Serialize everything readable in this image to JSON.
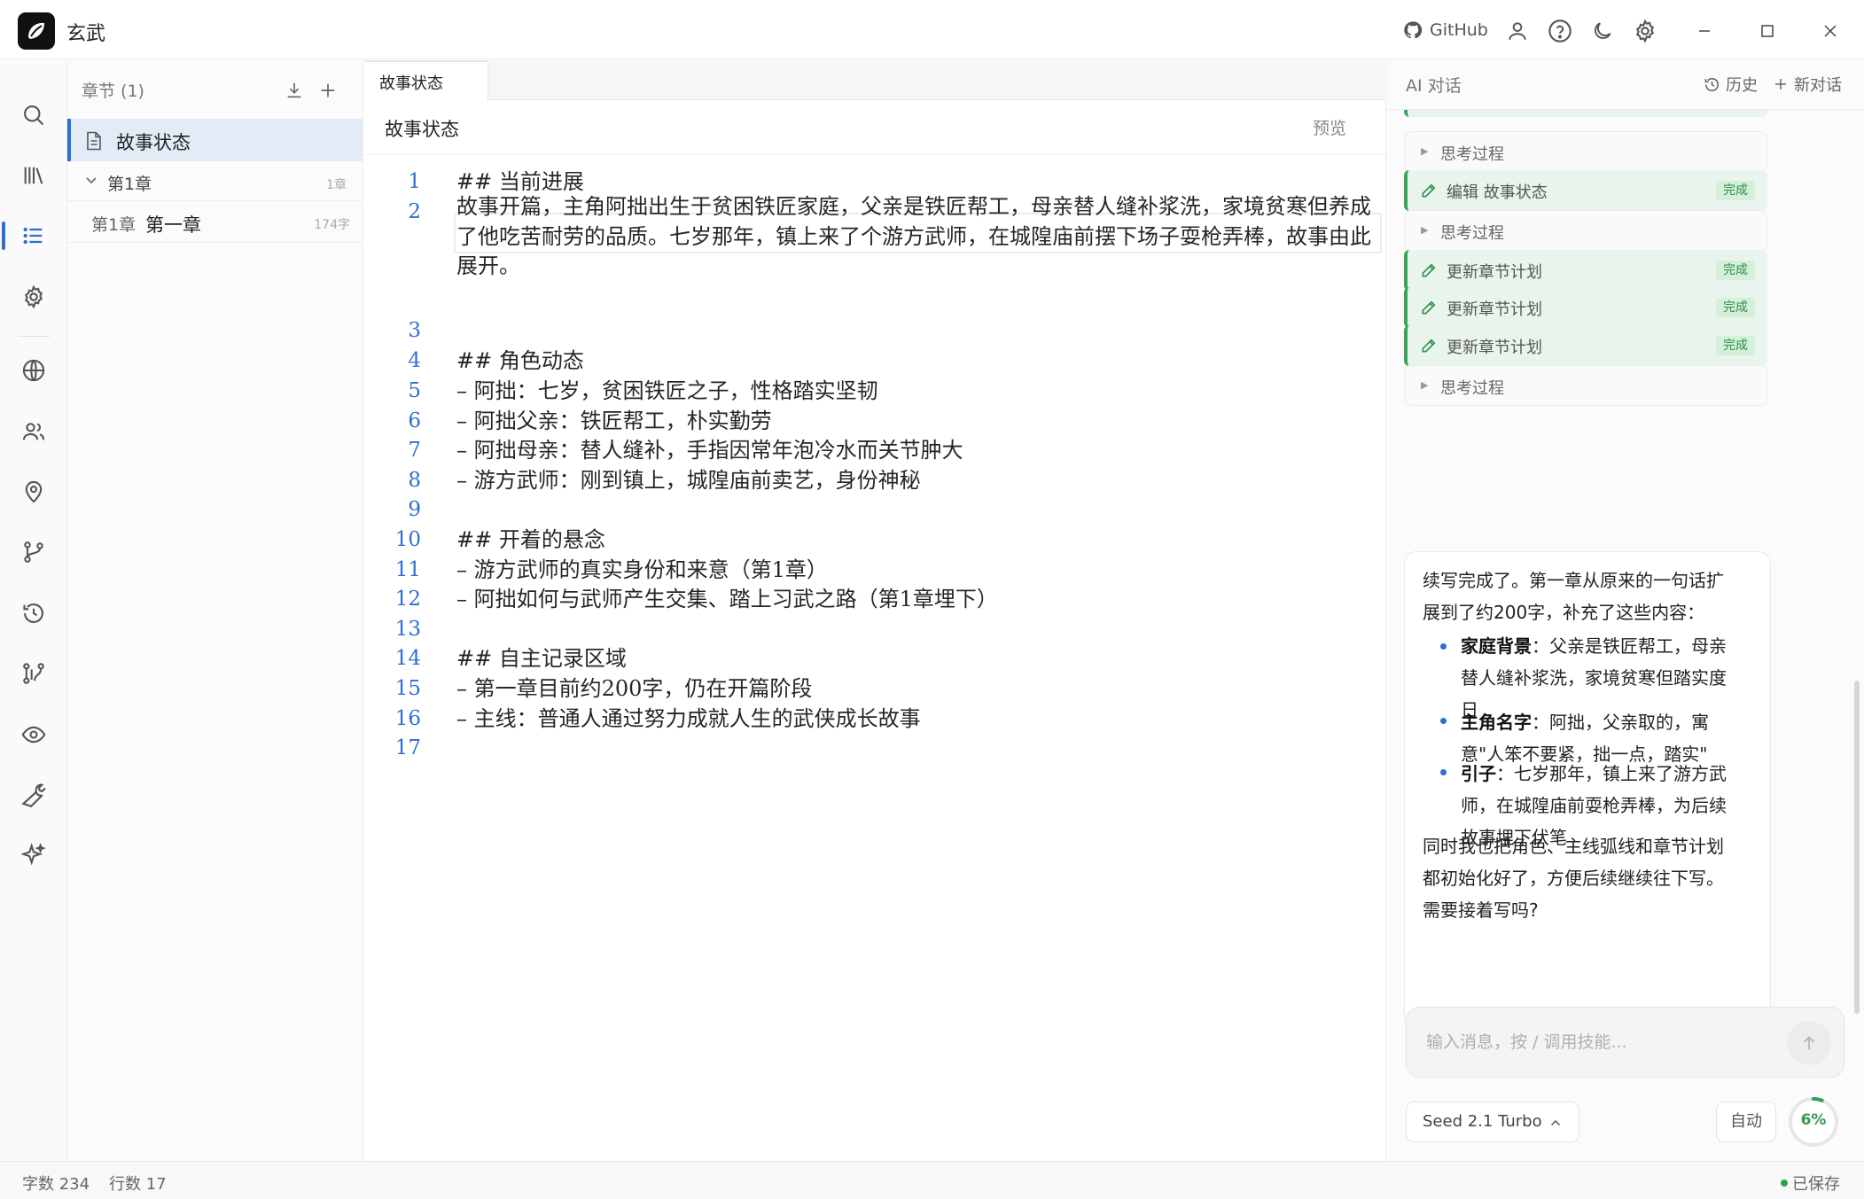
{
  "app": {
    "name": "玄武"
  },
  "titlebar": {
    "github_label": "GitHub"
  },
  "sidebar": {
    "header": "章节 (1)",
    "active_item": "故事状态",
    "volume": {
      "label": "第1章",
      "count": "1章"
    },
    "chapter": {
      "number": "第1章",
      "title": "第一章",
      "count": "174字"
    }
  },
  "editor": {
    "tab_label": "故事状态",
    "title": "故事状态",
    "preview_label": "预览",
    "lines": [
      {
        "n": "1",
        "text": "##  当前进展"
      },
      {
        "n": "2",
        "text": "故事开篇，主角阿拙出生于贫困铁匠家庭，父亲是铁匠帮工，母亲替人缝补浆洗，家境贫寒但养成了他吃苦耐劳的品质。七岁那年，镇上来了个游方武师，在城隍庙前摆下场子耍枪弄棒，故事由此展开。"
      },
      {
        "n": "3",
        "text": ""
      },
      {
        "n": "4",
        "text": "##  角色动态"
      },
      {
        "n": "5",
        "text": "–  阿拙：七岁，贫困铁匠之子，性格踏实坚韧"
      },
      {
        "n": "6",
        "text": "–  阿拙父亲：铁匠帮工，朴实勤劳"
      },
      {
        "n": "7",
        "text": "–  阿拙母亲：替人缝补，手指因常年泡冷水而关节肿大"
      },
      {
        "n": "8",
        "text": "–  游方武师：刚到镇上，城隍庙前卖艺，身份神秘"
      },
      {
        "n": "9",
        "text": ""
      },
      {
        "n": "10",
        "text": "##  开着的悬念"
      },
      {
        "n": "11",
        "text": "–  游方武师的真实身份和来意（第1章）"
      },
      {
        "n": "12",
        "text": "–  阿拙如何与武师产生交集、踏上习武之路（第1章埋下）"
      },
      {
        "n": "13",
        "text": ""
      },
      {
        "n": "14",
        "text": "##  自主记录区域"
      },
      {
        "n": "15",
        "text": "–  第一章目前约200字，仍在开篇阶段"
      },
      {
        "n": "16",
        "text": "–  主线：普通人通过努力成就人生的武侠成长故事"
      },
      {
        "n": "17",
        "text": ""
      }
    ]
  },
  "ai": {
    "title": "AI 对话",
    "history_label": "历史",
    "new_chat_label": "新对话",
    "blocks": [
      {
        "kind": "think",
        "label": "思考过程"
      },
      {
        "kind": "tool",
        "label": "编辑 故事状态",
        "status": "完成"
      },
      {
        "kind": "think",
        "label": "思考过程"
      },
      {
        "kind": "tool",
        "label": "更新章节计划",
        "status": "完成"
      },
      {
        "kind": "tool",
        "label": "更新章节计划",
        "status": "完成"
      },
      {
        "kind": "tool",
        "label": "更新章节计划",
        "status": "完成"
      },
      {
        "kind": "think",
        "label": "思考过程"
      }
    ],
    "message": {
      "intro_l1": "续写完成了。第一章从原来的一句话扩",
      "intro_l2": "展到了约200字，补充了这些内容：",
      "b1_title": "家庭背景",
      "b1_l1": "：父亲是铁匠帮工，母亲",
      "b1_l2": "替人缝补浆洗，家境贫寒但踏实度",
      "b1_l3": "日",
      "b2_title": "主角名字",
      "b2_l1": "：阿拙，父亲取的，寓",
      "b2_l2": "意\"人笨不要紧，拙一点，踏实\"",
      "b3_title": "引子",
      "b3_l1": "：七岁那年，镇上来了游方武",
      "b3_l2": "师，在城隍庙前耍枪弄棒，为后续",
      "b3_l3": "故事埋下伏笔",
      "outro_l1": "同时我也把角色、主线弧线和章节计划",
      "outro_l2": "都初始化好了，方便后续继续往下写。",
      "outro_l3": "需要接着写吗?"
    },
    "input_placeholder": "输入消息，按 / 调用技能...",
    "model": "Seed 2.1 Turbo",
    "auto_label": "自动",
    "context_usage": "6%",
    "context_fraction": 0.06
  },
  "status": {
    "word_count": "字数 234",
    "line_count": "行数 17",
    "saved": "已保存"
  },
  "colors": {
    "accent": "#2f6fd1",
    "success": "#2fa24f",
    "tool_bg": "#e9f5ec"
  }
}
